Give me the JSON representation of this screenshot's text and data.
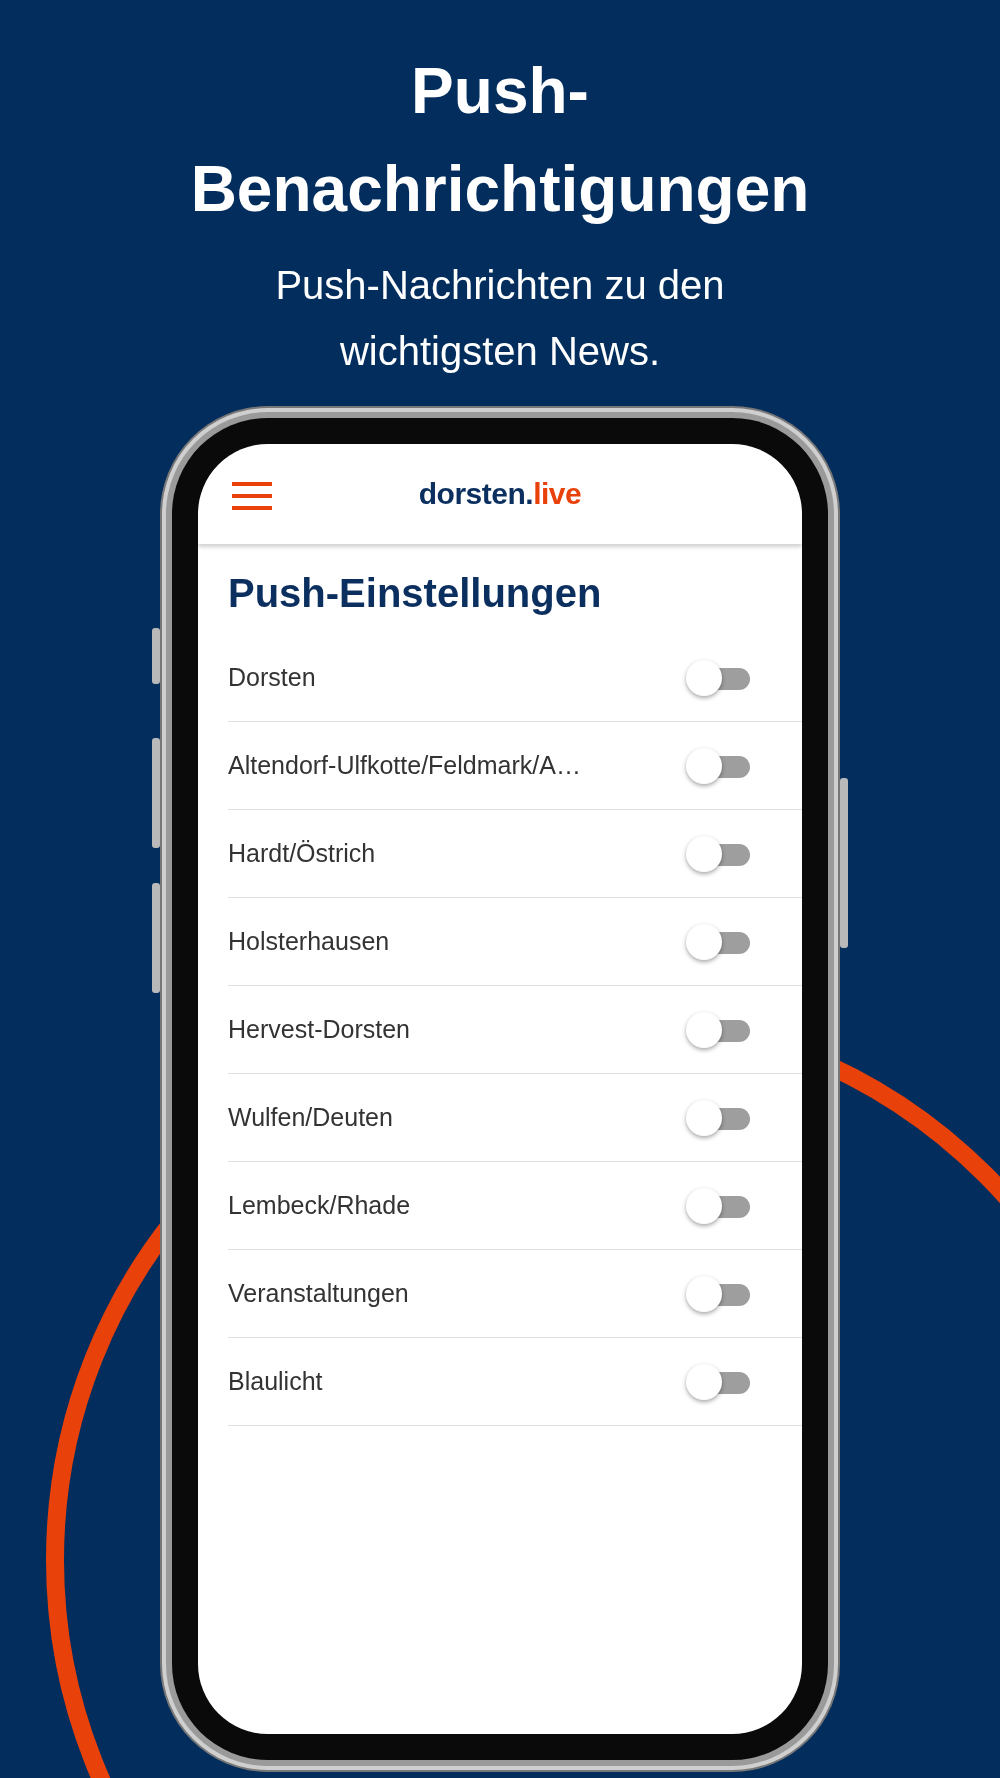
{
  "headline": "Push-Benachrichtigungen",
  "subline": "Push-Nachrichten zu den wichtigsten News.",
  "app": {
    "logo": {
      "part_1": "dorsten.",
      "part_2": "live"
    },
    "heading": "Push-Einstellungen",
    "settings": [
      {
        "label": "Dorsten",
        "on": false
      },
      {
        "label": "Altendorf-Ulfkotte/Feldmark/A…",
        "on": false
      },
      {
        "label": "Hardt/Östrich",
        "on": false
      },
      {
        "label": "Holsterhausen",
        "on": false
      },
      {
        "label": "Hervest-Dorsten",
        "on": false
      },
      {
        "label": "Wulfen/Deuten",
        "on": false
      },
      {
        "label": "Lembeck/Rhade",
        "on": false
      },
      {
        "label": "Veranstaltungen",
        "on": false
      },
      {
        "label": "Blaulicht",
        "on": false
      }
    ]
  }
}
